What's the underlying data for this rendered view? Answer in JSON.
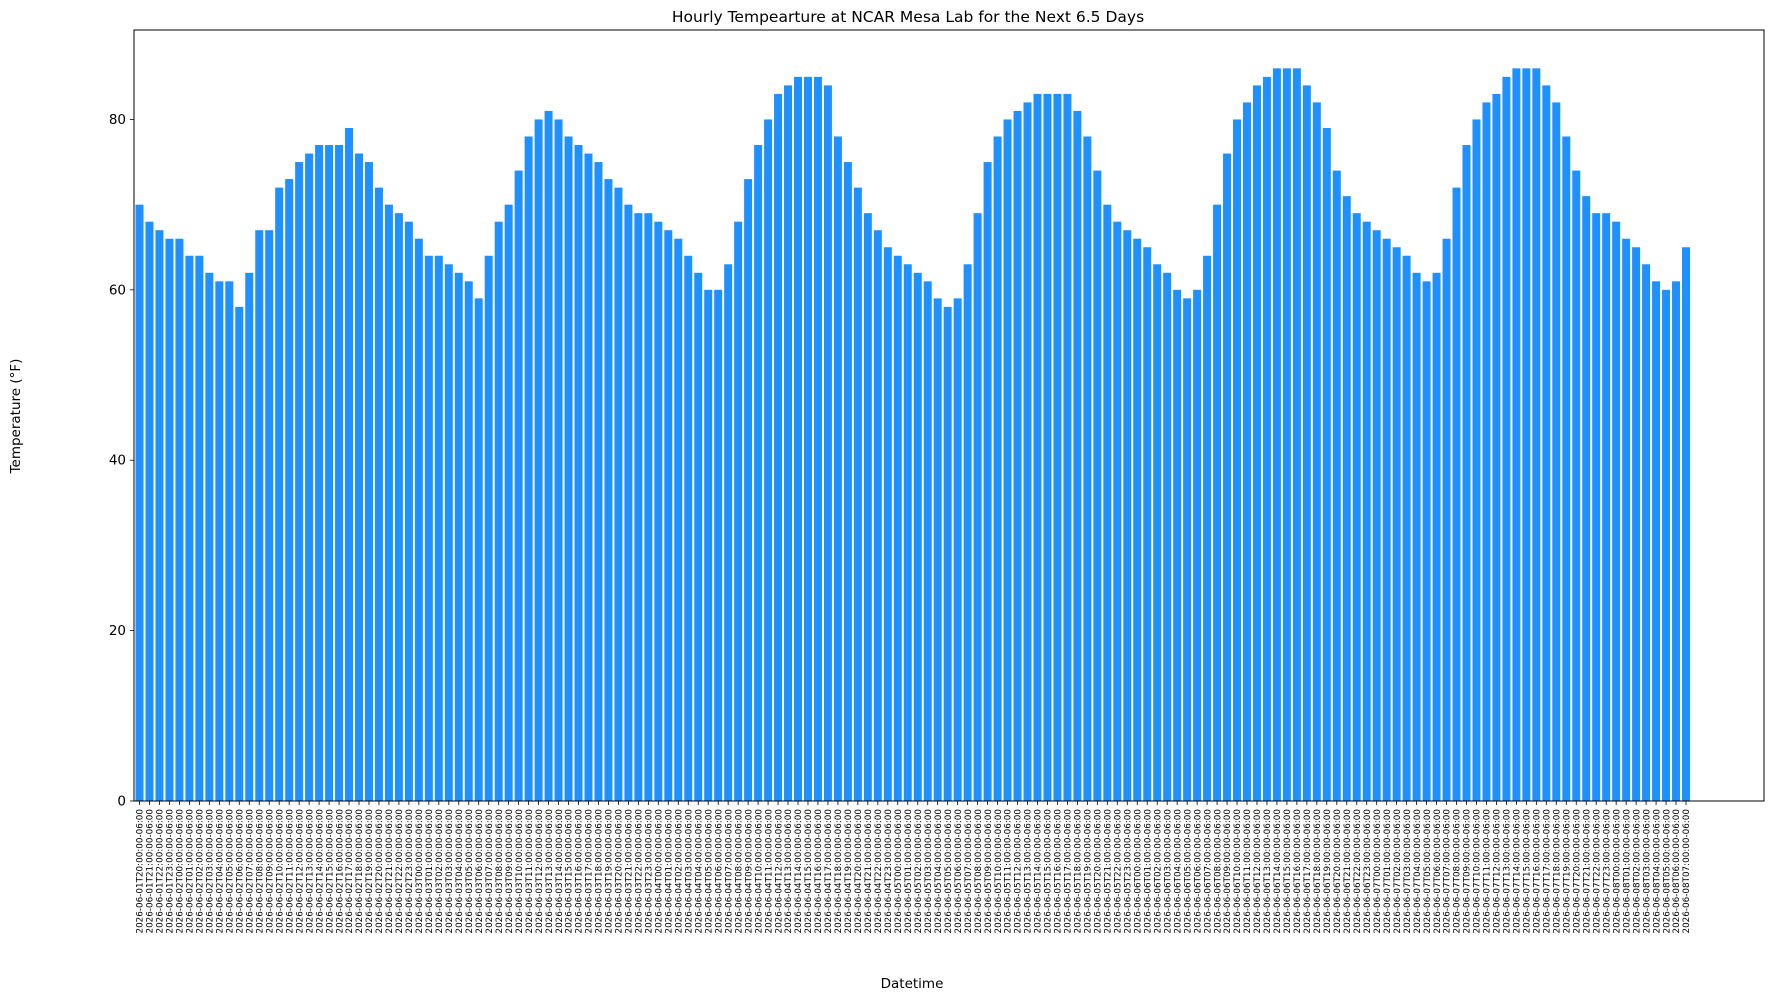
{
  "chart_data": {
    "type": "bar",
    "title": "Hourly Tempearture at NCAR Mesa Lab for the Next 6.5 Days",
    "xlabel": "Datetime",
    "ylabel": "Temperature (°F)",
    "ylim": [
      0,
      90.5
    ],
    "yticks": [
      0,
      20,
      40,
      60,
      80
    ],
    "grid": false,
    "bar_color": "#1e90ff",
    "categories": [
      "2026-06-01T20:00:00-06:00",
      "2026-06-01T21:00:00-06:00",
      "2026-06-01T22:00:00-06:00",
      "2026-06-01T23:00:00-06:00",
      "2026-06-02T00:00:00-06:00",
      "2026-06-02T01:00:00-06:00",
      "2026-06-02T02:00:00-06:00",
      "2026-06-02T03:00:00-06:00",
      "2026-06-02T04:00:00-06:00",
      "2026-06-02T05:00:00-06:00",
      "2026-06-02T06:00:00-06:00",
      "2026-06-02T07:00:00-06:00",
      "2026-06-02T08:00:00-06:00",
      "2026-06-02T09:00:00-06:00",
      "2026-06-02T10:00:00-06:00",
      "2026-06-02T11:00:00-06:00",
      "2026-06-02T12:00:00-06:00",
      "2026-06-02T13:00:00-06:00",
      "2026-06-02T14:00:00-06:00",
      "2026-06-02T15:00:00-06:00",
      "2026-06-02T16:00:00-06:00",
      "2026-06-02T17:00:00-06:00",
      "2026-06-02T18:00:00-06:00",
      "2026-06-02T19:00:00-06:00",
      "2026-06-02T20:00:00-06:00",
      "2026-06-02T21:00:00-06:00",
      "2026-06-02T22:00:00-06:00",
      "2026-06-02T23:00:00-06:00",
      "2026-06-03T00:00:00-06:00",
      "2026-06-03T01:00:00-06:00",
      "2026-06-03T02:00:00-06:00",
      "2026-06-03T03:00:00-06:00",
      "2026-06-03T04:00:00-06:00",
      "2026-06-03T05:00:00-06:00",
      "2026-06-03T06:00:00-06:00",
      "2026-06-03T07:00:00-06:00",
      "2026-06-03T08:00:00-06:00",
      "2026-06-03T09:00:00-06:00",
      "2026-06-03T10:00:00-06:00",
      "2026-06-03T11:00:00-06:00",
      "2026-06-03T12:00:00-06:00",
      "2026-06-03T13:00:00-06:00",
      "2026-06-03T14:00:00-06:00",
      "2026-06-03T15:00:00-06:00",
      "2026-06-03T16:00:00-06:00",
      "2026-06-03T17:00:00-06:00",
      "2026-06-03T18:00:00-06:00",
      "2026-06-03T19:00:00-06:00",
      "2026-06-03T20:00:00-06:00",
      "2026-06-03T21:00:00-06:00",
      "2026-06-03T22:00:00-06:00",
      "2026-06-03T23:00:00-06:00",
      "2026-06-04T00:00:00-06:00",
      "2026-06-04T01:00:00-06:00",
      "2026-06-04T02:00:00-06:00",
      "2026-06-04T03:00:00-06:00",
      "2026-06-04T04:00:00-06:00",
      "2026-06-04T05:00:00-06:00",
      "2026-06-04T06:00:00-06:00",
      "2026-06-04T07:00:00-06:00",
      "2026-06-04T08:00:00-06:00",
      "2026-06-04T09:00:00-06:00",
      "2026-06-04T10:00:00-06:00",
      "2026-06-04T11:00:00-06:00",
      "2026-06-04T12:00:00-06:00",
      "2026-06-04T13:00:00-06:00",
      "2026-06-04T14:00:00-06:00",
      "2026-06-04T15:00:00-06:00",
      "2026-06-04T16:00:00-06:00",
      "2026-06-04T17:00:00-06:00",
      "2026-06-04T18:00:00-06:00",
      "2026-06-04T19:00:00-06:00",
      "2026-06-04T20:00:00-06:00",
      "2026-06-04T21:00:00-06:00",
      "2026-06-04T22:00:00-06:00",
      "2026-06-04T23:00:00-06:00",
      "2026-06-05T00:00:00-06:00",
      "2026-06-05T01:00:00-06:00",
      "2026-06-05T02:00:00-06:00",
      "2026-06-05T03:00:00-06:00",
      "2026-06-05T04:00:00-06:00",
      "2026-06-05T05:00:00-06:00",
      "2026-06-05T06:00:00-06:00",
      "2026-06-05T07:00:00-06:00",
      "2026-06-05T08:00:00-06:00",
      "2026-06-05T09:00:00-06:00",
      "2026-06-05T10:00:00-06:00",
      "2026-06-05T11:00:00-06:00",
      "2026-06-05T12:00:00-06:00",
      "2026-06-05T13:00:00-06:00",
      "2026-06-05T14:00:00-06:00",
      "2026-06-05T15:00:00-06:00",
      "2026-06-05T16:00:00-06:00",
      "2026-06-05T17:00:00-06:00",
      "2026-06-05T18:00:00-06:00",
      "2026-06-05T19:00:00-06:00",
      "2026-06-05T20:00:00-06:00",
      "2026-06-05T21:00:00-06:00",
      "2026-06-05T22:00:00-06:00",
      "2026-06-05T23:00:00-06:00",
      "2026-06-06T00:00:00-06:00",
      "2026-06-06T01:00:00-06:00",
      "2026-06-06T02:00:00-06:00",
      "2026-06-06T03:00:00-06:00",
      "2026-06-06T04:00:00-06:00",
      "2026-06-06T05:00:00-06:00",
      "2026-06-06T06:00:00-06:00",
      "2026-06-06T07:00:00-06:00",
      "2026-06-06T08:00:00-06:00",
      "2026-06-06T09:00:00-06:00",
      "2026-06-06T10:00:00-06:00",
      "2026-06-06T11:00:00-06:00",
      "2026-06-06T12:00:00-06:00",
      "2026-06-06T13:00:00-06:00",
      "2026-06-06T14:00:00-06:00",
      "2026-06-06T15:00:00-06:00",
      "2026-06-06T16:00:00-06:00",
      "2026-06-06T17:00:00-06:00",
      "2026-06-06T18:00:00-06:00",
      "2026-06-06T19:00:00-06:00",
      "2026-06-06T20:00:00-06:00",
      "2026-06-06T21:00:00-06:00",
      "2026-06-06T22:00:00-06:00",
      "2026-06-06T23:00:00-06:00",
      "2026-06-07T00:00:00-06:00",
      "2026-06-07T01:00:00-06:00",
      "2026-06-07T02:00:00-06:00",
      "2026-06-07T03:00:00-06:00",
      "2026-06-07T04:00:00-06:00",
      "2026-06-07T05:00:00-06:00",
      "2026-06-07T06:00:00-06:00",
      "2026-06-07T07:00:00-06:00",
      "2026-06-07T08:00:00-06:00",
      "2026-06-07T09:00:00-06:00",
      "2026-06-07T10:00:00-06:00",
      "2026-06-07T11:00:00-06:00",
      "2026-06-07T12:00:00-06:00",
      "2026-06-07T13:00:00-06:00",
      "2026-06-07T14:00:00-06:00",
      "2026-06-07T15:00:00-06:00",
      "2026-06-07T16:00:00-06:00",
      "2026-06-07T17:00:00-06:00",
      "2026-06-07T18:00:00-06:00",
      "2026-06-07T19:00:00-06:00",
      "2026-06-07T20:00:00-06:00",
      "2026-06-07T21:00:00-06:00",
      "2026-06-07T22:00:00-06:00",
      "2026-06-07T23:00:00-06:00",
      "2026-06-08T00:00:00-06:00",
      "2026-06-08T01:00:00-06:00",
      "2026-06-08T02:00:00-06:00",
      "2026-06-08T03:00:00-06:00",
      "2026-06-08T04:00:00-06:00",
      "2026-06-08T05:00:00-06:00",
      "2026-06-08T06:00:00-06:00",
      "2026-06-08T07:00:00-06:00"
    ],
    "values": [
      70,
      68,
      67,
      66,
      66,
      64,
      64,
      62,
      61,
      61,
      58,
      62,
      67,
      67,
      72,
      73,
      75,
      76,
      77,
      77,
      77,
      79,
      76,
      75,
      72,
      70,
      69,
      68,
      66,
      64,
      64,
      63,
      62,
      61,
      59,
      64,
      68,
      70,
      74,
      78,
      80,
      81,
      80,
      78,
      77,
      76,
      75,
      73,
      72,
      70,
      69,
      69,
      68,
      67,
      66,
      64,
      62,
      60,
      60,
      63,
      68,
      73,
      77,
      80,
      83,
      84,
      85,
      85,
      85,
      84,
      78,
      75,
      72,
      69,
      67,
      65,
      64,
      63,
      62,
      61,
      59,
      58,
      59,
      63,
      69,
      75,
      78,
      80,
      81,
      82,
      83,
      83,
      83,
      83,
      81,
      78,
      74,
      70,
      68,
      67,
      66,
      65,
      63,
      62,
      60,
      59,
      60,
      64,
      70,
      76,
      80,
      82,
      84,
      85,
      86,
      86,
      86,
      84,
      82,
      79,
      74,
      71,
      69,
      68,
      67,
      66,
      65,
      64,
      62,
      61,
      62,
      66,
      72,
      77,
      80,
      82,
      83,
      85,
      86,
      86,
      86,
      84,
      82,
      78,
      74,
      71,
      69,
      69,
      68,
      66,
      65,
      63,
      61,
      60,
      61,
      65
    ]
  }
}
